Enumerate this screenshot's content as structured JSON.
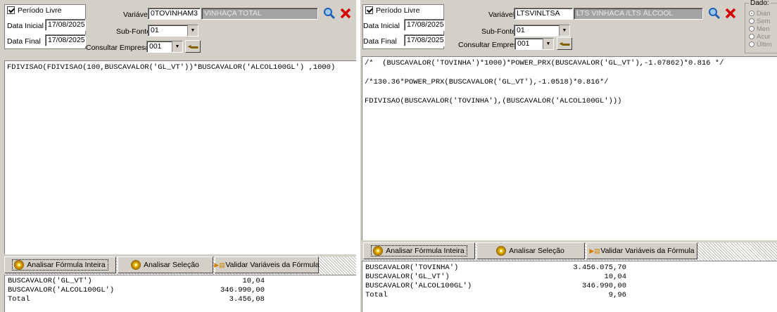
{
  "left": {
    "periodo_livre": "Período Livre",
    "data_inicial_label": "Data Inicial",
    "data_inicial": "17/08/2025",
    "data_final_label": "Data Final",
    "data_final": "17/08/2025",
    "variavel_label": "Variável",
    "variavel_value": "0TOVINHAM3",
    "variavel_desc": "VINHAÇA TOTAL",
    "subfonte_label": "Sub-Fonte",
    "subfonte_value": "01",
    "empresa_label": "Consultar Empresa",
    "empresa_value": "001",
    "formula_lines": [
      "FDIVISAO(FDIVISAO(100,BUSCAVALOR('GL_VT'))*BUSCAVALOR('ALCOL100GL') ,1000)"
    ],
    "tabs": [
      "Analisar Fórmula Inteira",
      "Analisar Seleção",
      "Validar Variáveis da Fórmula"
    ],
    "results": [
      {
        "label": "BUSCAVALOR('GL_VT')",
        "value": "10,04"
      },
      {
        "label": "BUSCAVALOR('ALCOL100GL')",
        "value": "346.990,00"
      },
      {
        "label": "Total",
        "value": "3.456,08"
      }
    ]
  },
  "right": {
    "periodo_livre": "Período Livre",
    "data_inicial_label": "Data Inicial",
    "data_inicial": "17/08/2025",
    "data_final_label": "Data Final",
    "data_final": "17/08/2025",
    "variavel_label": "Variável",
    "variavel_value": "LTSVINLTSA",
    "variavel_desc": "LTS VINHACA /LTS ÁLCOOL",
    "subfonte_label": "Sub-Fonte",
    "subfonte_value": "01",
    "empresa_label": "Consultar Empresa",
    "empresa_value": "001",
    "dado_label": "Dado:",
    "dado_options": [
      "Diári",
      "Sem",
      "Men",
      "Acur",
      "Últim"
    ],
    "formula_lines": [
      "/*  (BUSCAVALOR('TOVINHA')*1000)*POWER_PRX(BUSCAVALOR('GL_VT'),-1.07862)*0.816 */",
      "/*130.36*POWER_PRX(BUSCAVALOR('GL_VT'),-1.0518)*0.816*/",
      "FDIVISAO(BUSCAVALOR('TOVINHA'),(BUSCAVALOR('ALCOL100GL')))"
    ],
    "tabs": [
      "Analisar Fórmula Inteira",
      "Analisar Seleção",
      "Validar Variáveis da Fórmula"
    ],
    "results": [
      {
        "label": "BUSCAVALOR('TOVINHA')",
        "value": "3.456.075,70"
      },
      {
        "label": "BUSCAVALOR('GL_VT')",
        "value": "10,04"
      },
      {
        "label": "BUSCAVALOR('ALCOL100GL')",
        "value": "346.990,00"
      },
      {
        "label": "Total",
        "value": "9,96"
      }
    ]
  },
  "colors": {
    "panel": "#d4d0c8",
    "search_icon": "#1c5fb5",
    "close_icon": "#d40000",
    "gray_field": "#a3a3a3"
  },
  "icons": {
    "search": "magnifier-icon",
    "close": "close-x-icon",
    "gear": "gear-icon",
    "lookup": "lookup-icon"
  }
}
